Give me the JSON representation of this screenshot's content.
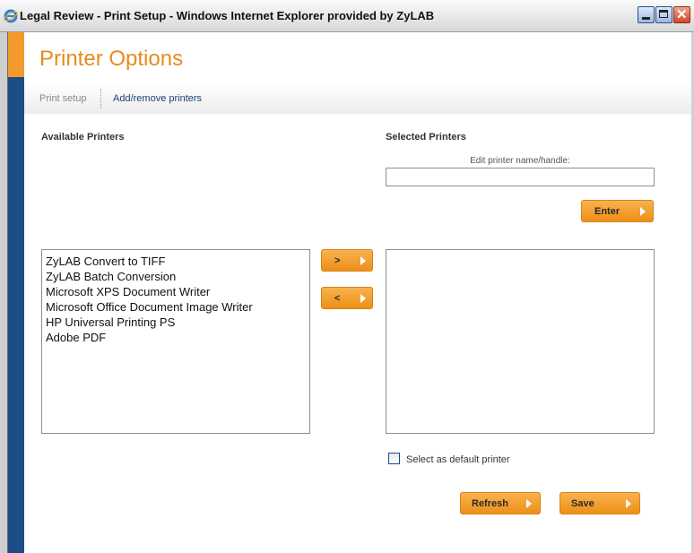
{
  "window": {
    "title": "Legal Review - Print Setup - Windows Internet Explorer provided by ZyLAB",
    "controls": [
      "minimize-icon",
      "maximize-icon",
      "close-icon"
    ]
  },
  "page": {
    "title": "Printer Options"
  },
  "tabs": [
    {
      "label": "Print setup",
      "active": false
    },
    {
      "label": "Add/remove printers",
      "active": true
    }
  ],
  "available": {
    "label": "Available Printers",
    "printers": [
      "ZyLAB Convert to TIFF",
      "ZyLAB Batch Conversion",
      "Microsoft XPS Document Writer",
      "Microsoft Office Document Image Writer",
      "HP Universal Printing PS",
      "Adobe PDF"
    ]
  },
  "selected": {
    "label": "Selected Printers",
    "edit_label": "Edit printer name/handle:",
    "edit_value": "",
    "printers": []
  },
  "buttons": {
    "enter": "Enter",
    "move_right": ">",
    "move_left": "<",
    "refresh": "Refresh",
    "save": "Save"
  },
  "default_printer": {
    "label": "Select as default printer",
    "checked": false
  },
  "colors": {
    "accent_orange": "#f29a2b",
    "accent_blue": "#1c4d87",
    "title_orange": "#e98a1c",
    "link_blue": "#1a3f77"
  }
}
